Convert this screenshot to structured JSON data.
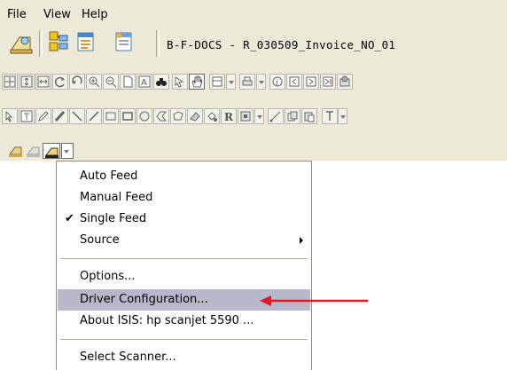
{
  "menubar": {
    "items": [
      "File",
      "View",
      "Help"
    ]
  },
  "document": {
    "title": "B-F-DOCS - R_030509_Invoice_NO_01"
  },
  "scan_toolbar": {
    "dropdown_icon": "chevron-down-icon"
  },
  "feed_menu": {
    "items": [
      {
        "label": "Auto Feed",
        "checked": false
      },
      {
        "label": "Manual Feed",
        "checked": false
      },
      {
        "label": "Single Feed",
        "checked": true
      },
      {
        "label": "Source",
        "has_submenu": true
      },
      {
        "label": "Options..."
      },
      {
        "label": "Driver Configuration...",
        "highlighted": true
      },
      {
        "label": "About ISIS: hp scanjet 5590 ..."
      },
      {
        "label": "Select Scanner..."
      }
    ],
    "check_glyph": "✔"
  },
  "colors": {
    "menu_highlight": "#b8b8cc",
    "arrow": "#e8161c",
    "chrome": "#ece9d8"
  }
}
